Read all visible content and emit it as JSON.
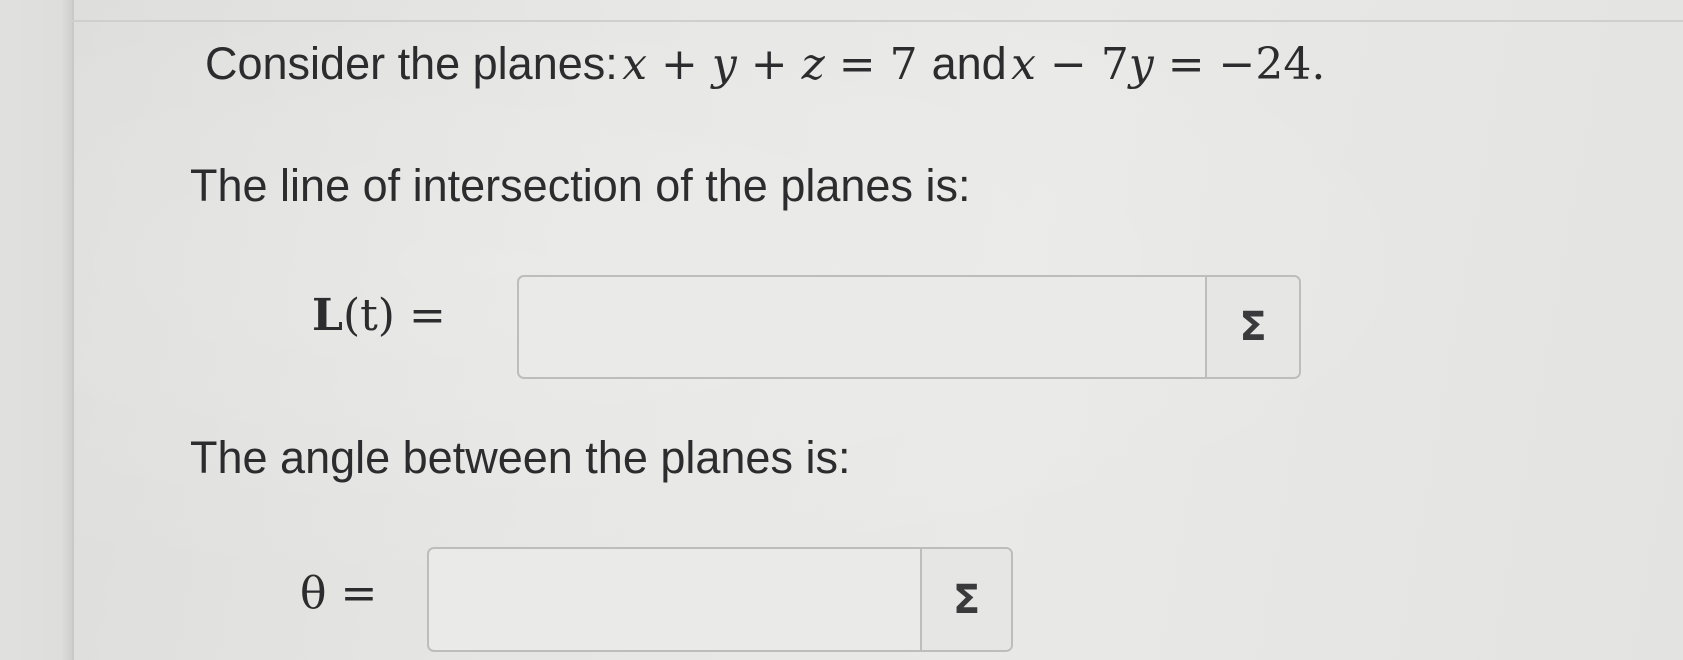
{
  "question": {
    "intro": "Consider the planes:",
    "plane1": {
      "a": "x",
      "b": "y",
      "c": "z",
      "rhs": "7"
    },
    "conj": "and",
    "plane2": {
      "a": "x",
      "coef": "7",
      "b": "y",
      "rhs": "−24"
    },
    "period": "."
  },
  "line_part": {
    "prompt": "The line of intersection of the planes is:",
    "lhs_bold": "L",
    "lhs_rest": "(t) =",
    "input_value": "",
    "palette_icon": "Σ"
  },
  "angle_part": {
    "prompt": "The angle between the planes is:",
    "lhs": "θ =",
    "input_value": "",
    "palette_icon": "Σ"
  }
}
